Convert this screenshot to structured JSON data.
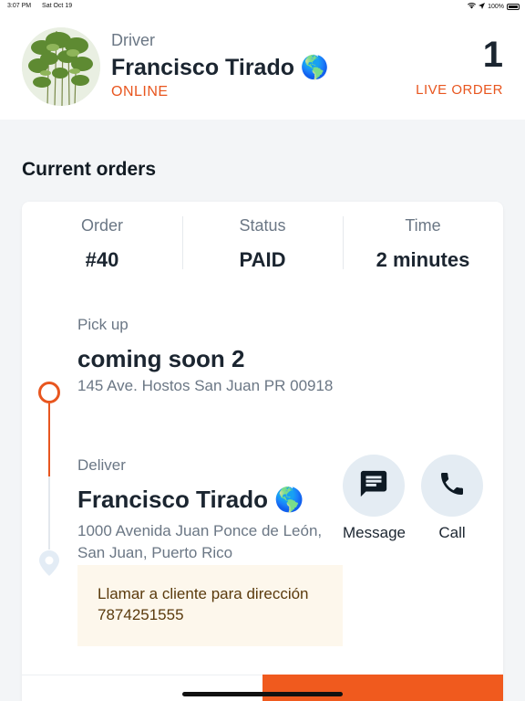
{
  "status_bar": {
    "time": "3:07 PM",
    "date": "Sat Oct 19",
    "battery": "100%"
  },
  "header": {
    "role_label": "Driver",
    "driver_name": "Francisco Tirado 🌎",
    "status": "ONLINE",
    "live_order_count": "1",
    "live_order_label": "LIVE ORDER"
  },
  "current_orders_title": "Current orders",
  "order": {
    "order_label": "Order",
    "order_value": "#40",
    "status_label": "Status",
    "status_value": "PAID",
    "time_label": "Time",
    "time_value": "2 minutes",
    "pickup": {
      "label": "Pick up",
      "name": "coming soon 2",
      "address": "145 Ave. Hostos San Juan PR 00918"
    },
    "deliver": {
      "label": "Deliver",
      "name": "Francisco Tirado 🌎",
      "address": "1000 Avenida Juan Ponce de León, San Juan, Puerto Rico"
    },
    "note": "Llamar a cliente para dirección 7874251555",
    "message_label": "Message",
    "call_label": "Call"
  },
  "colors": {
    "accent": "#e8561f",
    "action_bg": "#e4ecf3",
    "note_bg": "#fdf7ec"
  },
  "icons": [
    "wifi-icon",
    "location-arrow-icon",
    "battery-icon",
    "message-icon",
    "phone-icon",
    "map-pin-icon"
  ]
}
